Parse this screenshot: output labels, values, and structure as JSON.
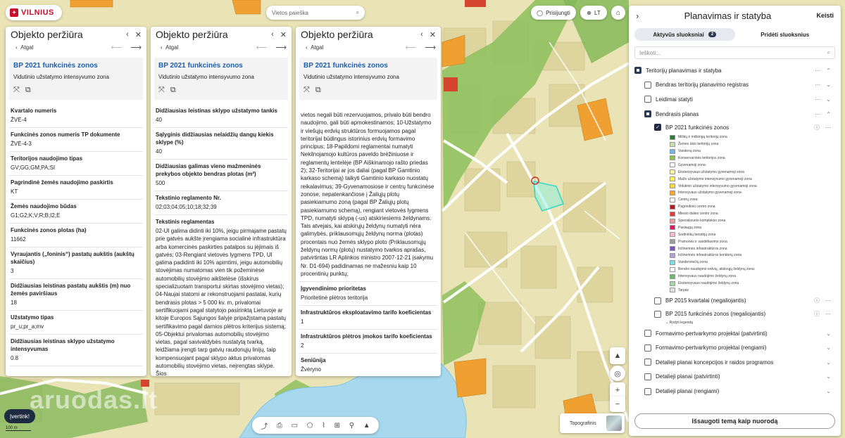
{
  "colors": {
    "accent": "#1f5ea8",
    "brand": "#c8102e",
    "dark": "#1f2a44",
    "highlight": "#43e6d8"
  },
  "logo": {
    "text": "VILNIUS",
    "icon": "city-crest-icon"
  },
  "search": {
    "placeholder": "Vietos paieška",
    "icon": "search-icon"
  },
  "topbar": {
    "login": "Prisijungti",
    "lang": "LT"
  },
  "panels": [
    {
      "title": "Objekto peržiūra",
      "back": "Atgal",
      "zone_title": "BP 2021 funkcinės zonos",
      "zone_sub": "Vidutinio užstatymo intensyvumo zona",
      "fields": [
        {
          "k": "Kvartalo numeris",
          "v": "ŽVĖ-4"
        },
        {
          "k": "Funkcinės zonos numeris TP dokumente",
          "v": "ŽVĖ-4-3"
        },
        {
          "k": "Teritorijos naudojimo tipas",
          "v": "GV;GG;GM;PA;SI"
        },
        {
          "k": "Pagrindinė žemės naudojimo paskirtis",
          "v": "KT"
        },
        {
          "k": "Žemės naudojimo būdas",
          "v": "G1;G2;K;V;R;B;I2;E"
        },
        {
          "k": "Funkcinės zonos plotas (ha)",
          "v": "11662"
        },
        {
          "k": "Vyraujantis („foninis“) pastatų aukštis (aukštų skaičius)",
          "v": "3"
        },
        {
          "k": "Didžiausias leistinas pastatų aukštis (m) nuo žemės paviršiaus",
          "v": "18"
        },
        {
          "k": "Užstatymo tipas",
          "v": "pr_u;pr_a;mv"
        },
        {
          "k": "Didžiausias leistinas sklypo užstatymo intensyvumas",
          "v": "0.8"
        }
      ]
    },
    {
      "title": "Objekto peržiūra",
      "back": "Atgal",
      "zone_title": "BP 2021 funkcinės zonos",
      "zone_sub": "Vidutinio užstatymo intensyvumo zona",
      "fields": [
        {
          "k": "Didžiausias leistinas sklypo užstatymo tankis",
          "v": "40"
        },
        {
          "k": "Sąlyginis didžiausias nelaidžių dangų kiekis sklype (%)",
          "v": "40"
        },
        {
          "k": "Didžiausias galimas vieno mažmeninės prekybos objekto bendras plotas (m²)",
          "v": "500"
        },
        {
          "k": "Tekstinio reglamento Nr.",
          "v": "02;03;04;05;10;18;32;39"
        },
        {
          "k": "Tekstinis reglamentas",
          "v": "02-UI galima didinti iki 10%, jeigu pirmajame pastatų prie gatvės aukšte įrengiama socialinė infrastruktūra arba komercinės paskirties patalpos su įėjimais iš gatvės; 03-Rengiant vietovės lygmens TPD, UI galima padidinti iki 10% apimtimi, jeigu automobilių stovėjimas numatomas vien tik požeminėse automobilių stovėjimo aikštelėse (išskirus specializuotam transportui skirtas stovėjimo vietas); 04-Naujai statomi ar rekonstruojami pastatai, kurių bendrasis plotas > 5 000 kv. m, privalomai sertifikuojami pagal statytojo pasirinktą Lietuvoje ar kitoje Europos Sąjungos šalyje pripažįstamą pastatų sertifikavimo pagal darnios plėtros kriterijus sistemą; 05-Objektui privalomas automobilių stovėjimo vietas, pagal savivaldybės nustatytą tvarką, leidžiama įrengti tarp gatvių raudonųjų linijų, taip kompensuojant pagal sklypo aktus privalomas automobilių stovėjimo vietas, neįrengtas sklype. Šios"
        }
      ]
    },
    {
      "title": "Objekto peržiūra",
      "back": "Atgal",
      "zone_title": "BP 2021 funkcinės zonos",
      "zone_sub": "Vidutinio užstatymo intensyvumo zona",
      "long": "vietos negali būti rezervuojamos, privalo būti bendro naudojimo, gali būti apmokestinamos; 10-Užstatymo ir viešųjų erdvių struktūros formuojamos pagal teritorijai būdingus istorinius erdvių formavimo principus; 18-Papildomi reglamentai numatyti Nekilnojamojo kultūros paveldo brėžiniuose ir reglamentų lentelėje (BP Aiškinamojo rašto priedas 2); 32-Teritorijai ar jos daliai (pagal BP Gamtinio karkaso schemą) taikyti Gamtinio karkaso nuostatų reikalavimus; 39-Gyvenamosiose ir centrų funkcinėse zonose, nepatenkančiose į Žaliųjų plotų pasiekiamumo zoną (pagal BP Žaliųjų plotų pasiekiamumo schemą), rengiant vietovės lygmens TPD, numatyti sklypą (-us) atskiriesiems želdynams. Tais atvejais, kai atskirųjų želdynų numatyti nėra galimybės, priklausomųjų želdynų norma (plotas) procentais nuo žemės sklypo ploto (Priklausomųjų želdynų normų (plotų) nustatymo tvarkos aprašas, patvirtintas LR Aplinkos ministro 2007-12-21 įsakymu Nr. D1-694) padidinamas ne mažesniu kaip 10 procentinių punktų;",
      "fields": [
        {
          "k": "Įgyvendinimo prioritetas",
          "v": "Prioritetinė plėtros teritorija"
        },
        {
          "k": "Infrastruktūros eksploatavimo tarifo koeficientas",
          "v": "1"
        },
        {
          "k": "Infrastruktūros plėtros įmokos tarifo koeficientas",
          "v": "2"
        },
        {
          "k": "Seniūnija",
          "v": "Žvėryno"
        }
      ]
    }
  ],
  "right": {
    "title": "Planavimas ir statyba",
    "edit": "Keisti",
    "tab_active": "Aktyvūs sluoksniai",
    "tab_badge": "2",
    "tab_add": "Pridėti sluoksnius",
    "filter_placeholder": "Ieškoti...",
    "layers_top": [
      {
        "label": "Teritorijų planavimas ir statyba",
        "checked": "partial",
        "indent": 0,
        "chev": "up"
      },
      {
        "label": "Bendras teritorijų planavimo registras",
        "checked": "no",
        "indent": 1,
        "chev": "down"
      },
      {
        "label": "Leidimai statyti",
        "checked": "no",
        "indent": 1,
        "chev": "down"
      },
      {
        "label": "Bendrasis planas",
        "checked": "partial",
        "indent": 1,
        "chev": "up"
      },
      {
        "label": "BP 2021 funkcinės zonos",
        "checked": "yes",
        "indent": 2,
        "chev": "none"
      }
    ],
    "legend": [
      {
        "label": "Miškų ir miškingų teritorijų zona",
        "color": "#2e7d32"
      },
      {
        "label": "Žemės ūkio teritorijų zona",
        "color": "#c5e1a5"
      },
      {
        "label": "Vandenų zona",
        "color": "#6fb7e8"
      },
      {
        "label": "Konservacinės teritorijos zona",
        "color": "#8bc34a"
      },
      {
        "label": "Gyvenamoji zona:",
        "color": "#ffffff"
      },
      {
        "label": "Ekstensyvaus užstatymo gyvenamoji zona",
        "color": "#fff59d"
      },
      {
        "label": "Mažo užstatymo intensyvumo gyvenamoji zona",
        "color": "#ffee58"
      },
      {
        "label": "Vidutinio užstatymo intensyvumo gyvenamoji zona",
        "color": "#fdd835"
      },
      {
        "label": "Intensyvaus užstatymo gyvenamoji zona",
        "color": "#f9a825"
      },
      {
        "label": "Centrų zona:",
        "color": "#ffffff"
      },
      {
        "label": "Pagrindinio centro zona",
        "color": "#b71c1c"
      },
      {
        "label": "Miesto dalies centro zona",
        "color": "#e53935"
      },
      {
        "label": "Specializuoto komplekso zona",
        "color": "#ef9a9a"
      },
      {
        "label": "Paslaugų zona",
        "color": "#d81b60"
      },
      {
        "label": "Sodininkų bendrijų zona",
        "color": "#f8bbd0"
      },
      {
        "label": "Pramonės ir sandėliavimo zona",
        "color": "#9e9e9e"
      },
      {
        "label": "Inžinerinės infrastruktūros zona",
        "color": "#7e57c2"
      },
      {
        "label": "Inžinerinės infrastruktūros koridorių zona",
        "color": "#b39ddb"
      },
      {
        "label": "Vandenviečių zona",
        "color": "#80deea"
      },
      {
        "label": "Bendro naudojimo erdvių, atskirųjų želdynų zona:",
        "color": "#ffffff"
      },
      {
        "label": "Intensyvaus naudojimo želdynų zona",
        "color": "#66bb6a"
      },
      {
        "label": "Ekstensyvaus naudojimo želdynų zona",
        "color": "#a5d6a7"
      },
      {
        "label": "Tarpas",
        "color": "#e0e0e0"
      }
    ],
    "layers_bottom": [
      {
        "label": "BP 2015 kvartalai (negaliojantis)",
        "checked": "no",
        "indent": 2
      },
      {
        "label": "BP 2015 funkcinės zonos (negaliojantis)",
        "checked": "no",
        "indent": 2
      },
      {
        "label": "Formavimo-pertvarkymo projektai (patvirtinti)",
        "checked": "no",
        "indent": 1
      },
      {
        "label": "Formavimo-pertvarkymo projektai (rengiami)",
        "checked": "no",
        "indent": 1
      },
      {
        "label": "Detalieji planai koncepcijos ir raidos programos",
        "checked": "no",
        "indent": 1
      },
      {
        "label": "Detalieji planai (patvirtinti)",
        "checked": "no",
        "indent": 1
      },
      {
        "label": "Detalieji planai (rengiami)",
        "checked": "no",
        "indent": 1
      }
    ],
    "show_legend": "Rodyti legendą",
    "save": "Išsaugoti temą kaip nuorodą"
  },
  "bottom": {
    "basemap": "Topografinis",
    "rate": "Įvertink!",
    "scale": "100 m",
    "watermark": "aruodas.lt"
  },
  "toolbar": [
    "share-icon",
    "print-icon",
    "measure-icon",
    "draw-polygon-icon",
    "draw-line-icon",
    "insert-icon",
    "pin-icon",
    "image-icon"
  ]
}
